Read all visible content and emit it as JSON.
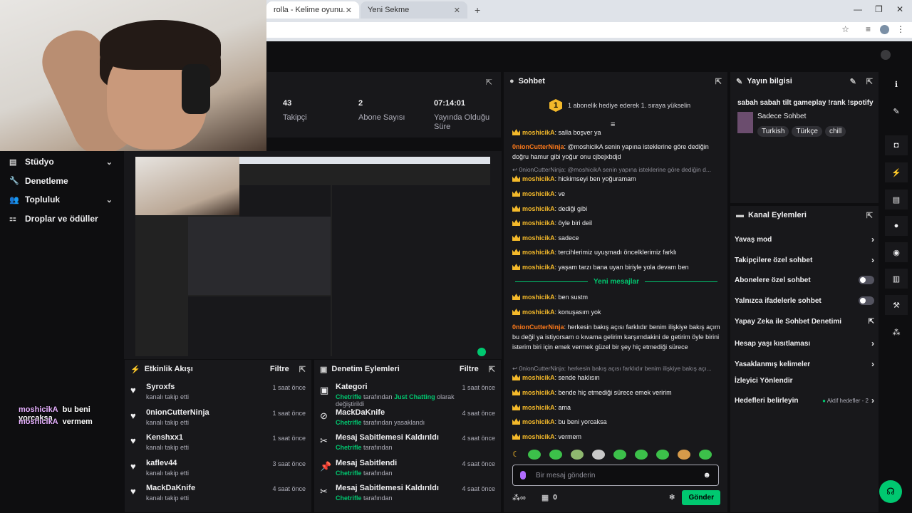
{
  "browser": {
    "tabs": [
      {
        "label": "rolla - Kelime oyunu. Günlük",
        "close": "✕"
      },
      {
        "label": "Yeni Sekme",
        "close": "✕"
      }
    ],
    "new_tab": "+",
    "window": {
      "minimize": "—",
      "restore": "❐",
      "close": "✕"
    }
  },
  "nav": {
    "items": [
      {
        "label": "Stüdyo",
        "icon": "▤",
        "chevron": "⌄"
      },
      {
        "label": "Denetleme",
        "icon": "🔧"
      },
      {
        "label": "Topluluk",
        "icon": "👥",
        "chevron": "⌄"
      },
      {
        "label": "Droplar ve ödüller",
        "icon": "⚏"
      }
    ]
  },
  "overlay_chat": [
    {
      "user": "moshicikA",
      "text": "bu beni yorcaksa"
    },
    {
      "user": "moshicikA",
      "text": "vermem"
    }
  ],
  "stats": [
    {
      "value": "43",
      "label": "Takipçi"
    },
    {
      "value": "2",
      "label": "Abone Sayısı"
    },
    {
      "value": "07:14:01",
      "label": "Yayında Olduğu Süre"
    }
  ],
  "activity": {
    "title": "Etkinlik Akışı",
    "filter": "Filtre",
    "items": [
      {
        "user": "Syroxfs",
        "desc": "kanalı takip etti",
        "time": "1 saat önce"
      },
      {
        "user": "0nionCutterNinja",
        "desc": "kanalı takip etti",
        "time": "1 saat önce"
      },
      {
        "user": "Kenshxx1",
        "desc": "kanalı takip etti",
        "time": "1 saat önce"
      },
      {
        "user": "kaflev44",
        "desc": "kanalı takip etti",
        "time": "3 saat önce"
      },
      {
        "user": "MackDaKnife",
        "desc": "kanalı takip etti",
        "time": "4 saat önce"
      }
    ]
  },
  "modlog": {
    "title": "Denetim Eylemleri",
    "filter": "Filtre",
    "items": [
      {
        "title": "Kategori",
        "actor": "Chetrifle",
        "mid": " tarafından ",
        "target": "Just Chatting",
        "rest": " olarak değiştirildi",
        "time": "1 saat önce",
        "icon": "▣"
      },
      {
        "title": "MackDaKnife",
        "actor": "Chetrifle",
        "mid": " tarafından yasaklandı",
        "target": "",
        "rest": "",
        "time": "4 saat önce",
        "icon": "⊘"
      },
      {
        "title": "Mesaj Sabitlemesi Kaldırıldı",
        "actor": "Chetrifle",
        "mid": " tarafından",
        "target": "",
        "rest": "",
        "time": "4 saat önce",
        "icon": "✂"
      },
      {
        "title": "Mesaj Sabitlendi",
        "actor": "Chetrifle",
        "mid": " tarafından",
        "target": "",
        "rest": "",
        "time": "4 saat önce",
        "icon": "📌"
      },
      {
        "title": "Mesaj Sabitlemesi Kaldırıldı",
        "actor": "Chetrifle",
        "mid": " tarafından",
        "target": "",
        "rest": "",
        "time": "4 saat önce",
        "icon": "✂"
      }
    ]
  },
  "chat": {
    "title": "Sohbet",
    "gift_rank": "1",
    "gift_text": "1 abonelik hediye ederek 1. sıraya yükselin",
    "messages": [
      {
        "user": "moshicikA",
        "text": " salla boşver ya"
      },
      {
        "user": "0nionCutterNinja",
        "text": " @moshicikA senin yapına isteklerine göre dediğin doğru hamur gibi yoğur onu cjbejxbdjd"
      },
      {
        "user": "moshicikA",
        "text": " hickimseyi ben yoğuramam"
      },
      {
        "user": "moshicikA",
        "text": " ve"
      },
      {
        "user": "moshicikA",
        "text": " dediği gibi"
      },
      {
        "user": "moshicikA",
        "text": " öyle biri deil"
      },
      {
        "user": "moshicikA",
        "text": " sadece"
      },
      {
        "user": "moshicikA",
        "text": " tercihlerimiz uyuşmadı öncelklerimiz farklı"
      },
      {
        "user": "moshicikA",
        "text": " yaşam tarzı bana uyan biriyle yola devam ben"
      },
      {
        "user": "moshicikA",
        "text": " ben sustm"
      },
      {
        "user": "moshicikA",
        "text": " konuşasım yok"
      },
      {
        "user": "0nionCutterNinja",
        "text": " herkesin bakış açısı farklıdır benim ilişkiye bakış açım bu değil ya istiyorsam o kıvama gelirim karşımdakini de getirim öyle birini isterim biri için emek vermek güzel bir şey hiç etmediği sürece"
      },
      {
        "user": "moshicikA",
        "text": " sende haklısın"
      },
      {
        "user": "moshicikA",
        "text": " bende hiç etmediği sürece emek veririm"
      },
      {
        "user": "moshicikA",
        "text": " ama"
      },
      {
        "user": "moshicikA",
        "text": " bu beni yorcaksa"
      },
      {
        "user": "moshicikA",
        "text": " vermem"
      }
    ],
    "reply1": "↩ 0nionCutterNinja: @moshicikA senin yapına isteklerine göre dediğin d...",
    "reply2": "↩ 0nionCutterNinja: herkesin bakış açısı farklıdır benim ilişkiye bakış açı...",
    "new_messages": "Yeni mesajlar",
    "input_placeholder": "Bir mesaj gönderin",
    "points": "0",
    "send": "Gönder"
  },
  "stream_info": {
    "title": "Yayın bilgisi",
    "stream_title": "sabah sabah tilt gameplay !rank !spotify",
    "category": "Sadece Sohbet",
    "tags": [
      "Turkish",
      "Türkçe",
      "chill"
    ]
  },
  "channel_actions": {
    "title": "Kanal Eylemleri",
    "items": [
      {
        "label": "Yavaş mod",
        "kind": "arrow"
      },
      {
        "label": "Takipçilere özel sohbet",
        "kind": "arrow"
      },
      {
        "label": "Abonelere özel sohbet",
        "kind": "toggle"
      },
      {
        "label": "Yalnızca ifadelerle sohbet",
        "kind": "toggle"
      },
      {
        "label": "Yapay Zeka ile Sohbet Denetimi",
        "kind": "external"
      },
      {
        "label": "Hesap yaşı kısıtlaması",
        "kind": "arrow"
      },
      {
        "label": "Yasaklanmış kelimeler",
        "kind": "arrow"
      },
      {
        "label": "İzleyici Yönlendir",
        "kind": "none"
      },
      {
        "label": "Hedefleri belirleyin",
        "kind": "arrow"
      }
    ],
    "goals_status": "Aktif hedefler - 2"
  },
  "colors": {
    "accent": "#00c870",
    "sub": "#f4b92a",
    "bg": "#0e0e10",
    "panel": "#18181b"
  }
}
